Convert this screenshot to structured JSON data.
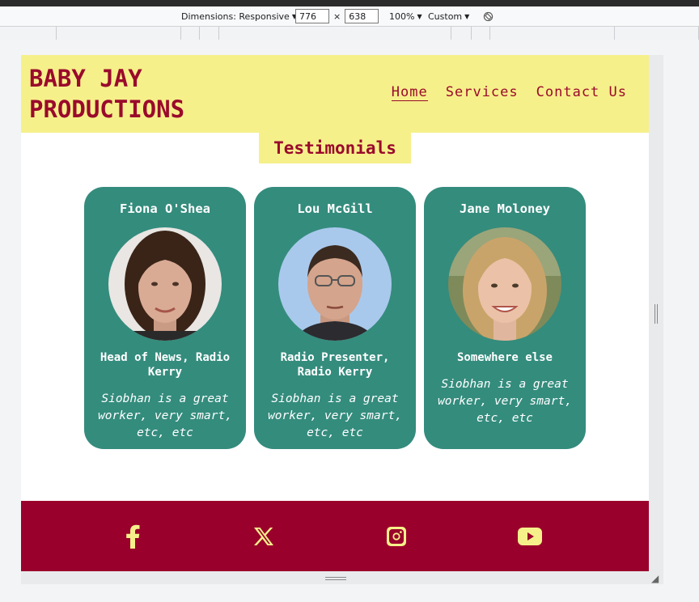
{
  "devtools": {
    "dimensions_label": "Dimensions: Responsive",
    "width": "776",
    "times": "×",
    "height": "638",
    "zoom": "100%",
    "throttle": "Custom"
  },
  "header": {
    "brand": "BABY JAY PRODUCTIONS",
    "nav": [
      {
        "label": "Home",
        "active": true
      },
      {
        "label": "Services",
        "active": false
      },
      {
        "label": "Contact Us",
        "active": false
      }
    ]
  },
  "testimonials": {
    "title": "Testimonials",
    "cards": [
      {
        "name": "Fiona O'Shea",
        "role": "Head of News, Radio Kerry",
        "quote": "Siobhan is a great worker, very smart, etc, etc"
      },
      {
        "name": "Lou McGill",
        "role": "Radio Presenter, Radio Kerry",
        "quote": "Siobhan is a great worker, very smart, etc, etc"
      },
      {
        "name": "Jane Moloney",
        "role": "Somewhere else",
        "quote": "Siobhan is a great worker, very smart, etc, etc"
      }
    ]
  },
  "footer": {
    "icons": [
      "facebook-icon",
      "x-twitter-icon",
      "instagram-icon",
      "youtube-icon"
    ]
  },
  "colors": {
    "brand_maroon": "#9a0a2c",
    "header_yellow": "#f6f08a",
    "card_teal": "#348c7d",
    "footer_maroon": "#9a002c"
  }
}
